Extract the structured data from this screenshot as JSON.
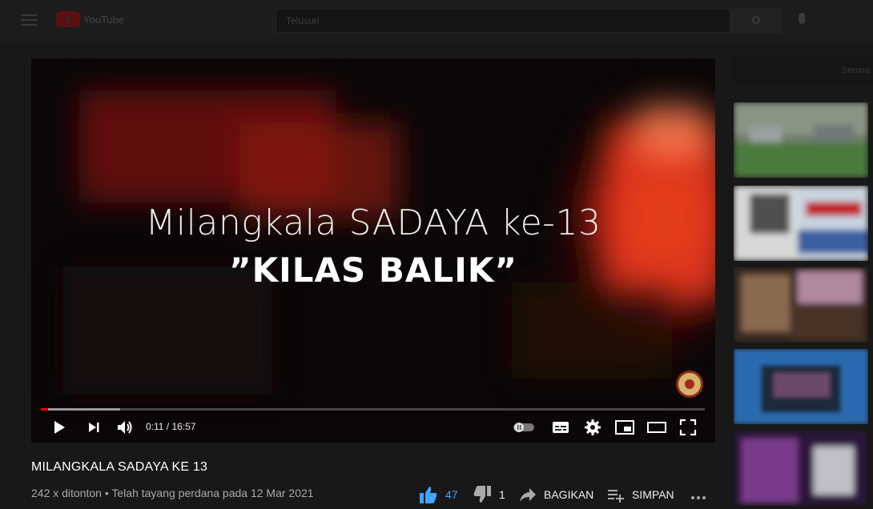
{
  "header": {
    "logo_text": "YouTube",
    "search_placeholder": "Telusuri"
  },
  "player": {
    "title_line1": "Milangkala SADAYA ke-13",
    "title_line2": "”KILAS BALIK”",
    "time_display": "0:11 / 16:57",
    "progress_played_fraction": 0.011,
    "progress_loaded_fraction": 0.12,
    "icons": [
      "play-icon",
      "next-icon",
      "volume-icon",
      "autoplay-toggle-icon",
      "subtitles-icon",
      "settings-icon",
      "miniplayer-icon",
      "theater-mode-icon",
      "fullscreen-icon"
    ]
  },
  "video": {
    "title": "MILANGKALA SADAYA KE 13",
    "meta": "242 x ditonton • Telah tayang perdana pada 12 Mar 2021",
    "likes": "47",
    "dislikes": "1",
    "share_label": "BAGIKAN",
    "save_label": "SIMPAN"
  },
  "sidebar": {
    "chip_label": "Semua"
  },
  "colors": {
    "accent_red": "#ff0000",
    "like_blue": "#3ea6ff",
    "background": "#181818"
  }
}
